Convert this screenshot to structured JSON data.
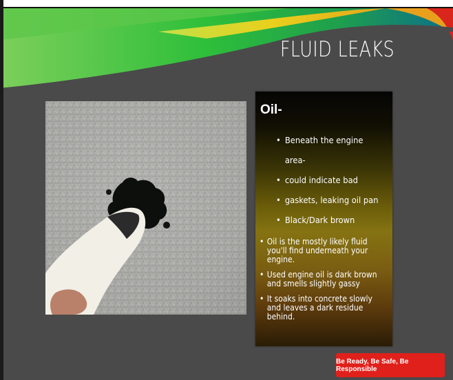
{
  "slide": {
    "title": "FLUID LEAKS",
    "panel": {
      "heading": "Oil-",
      "sub_points": [
        "Beneath the engine area-",
        "could indicate bad",
        "gaskets, leaking oil pan",
        "Black/Dark brown"
      ],
      "main_points": [
        "Oil is the mostly likely fluid you'll find underneath your engine.",
        " Used engine oil is dark brown and smells slightly gassy",
        "It soaks into concrete slowly and leaves a dark residue behind."
      ]
    },
    "footer_badge": "Be Ready, Be Safe, Be Responsible"
  },
  "colors": {
    "background": "#4a4a4a",
    "badge": "#e0201b",
    "swoosh_green": "#2fbf3a",
    "swoosh_yellow": "#f3d21a",
    "swoosh_red": "#d8261c"
  }
}
